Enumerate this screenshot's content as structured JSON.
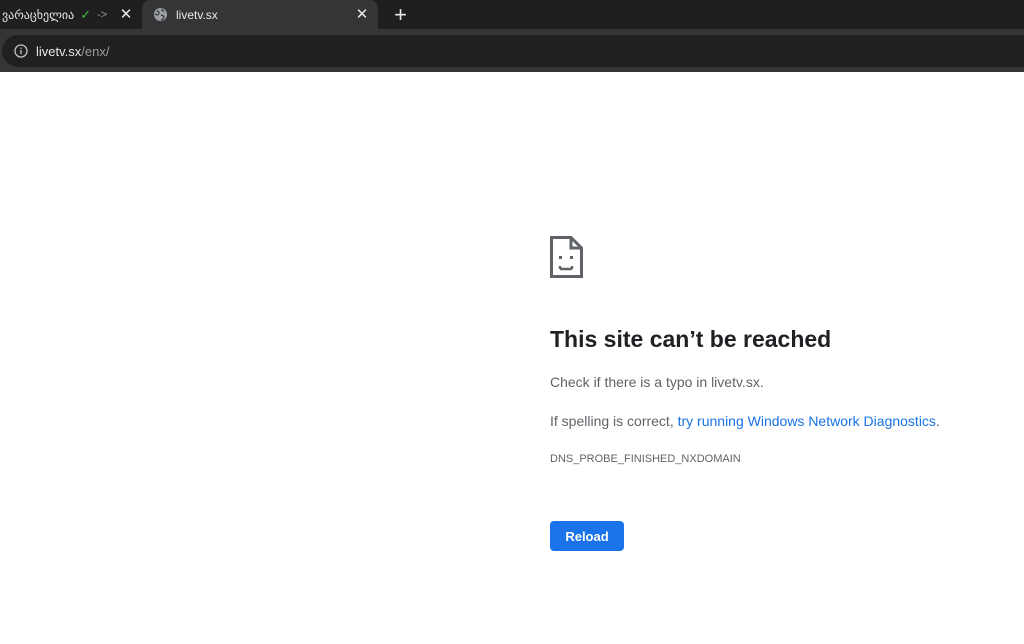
{
  "tabs": [
    {
      "title": "ვარაცხელია",
      "status_arrow": "->",
      "active": false
    },
    {
      "title": "livetv.sx",
      "active": true
    }
  ],
  "icons": {
    "tab_check": "check-icon",
    "tab_close": "close-icon",
    "favicon": "globe-icon",
    "new_tab": "plus-icon",
    "site_info": "info-icon",
    "error": "sad-page-icon"
  },
  "address_bar": {
    "host": "livetv.sx",
    "path": "/enx/"
  },
  "error_page": {
    "heading": "This site can’t be reached",
    "line1": "Check if there is a typo in livetv.sx.",
    "line2_prefix": "If spelling is correct, ",
    "line2_link": "try running Windows Network Diagnostics",
    "line2_suffix": ".",
    "error_code": "DNS_PROBE_FINISHED_NXDOMAIN",
    "reload_label": "Reload"
  },
  "colors": {
    "accent": "#1a73e8",
    "check": "#3fbf4a",
    "tabstrip": "#1f1f1f",
    "toolbar": "#353535"
  }
}
